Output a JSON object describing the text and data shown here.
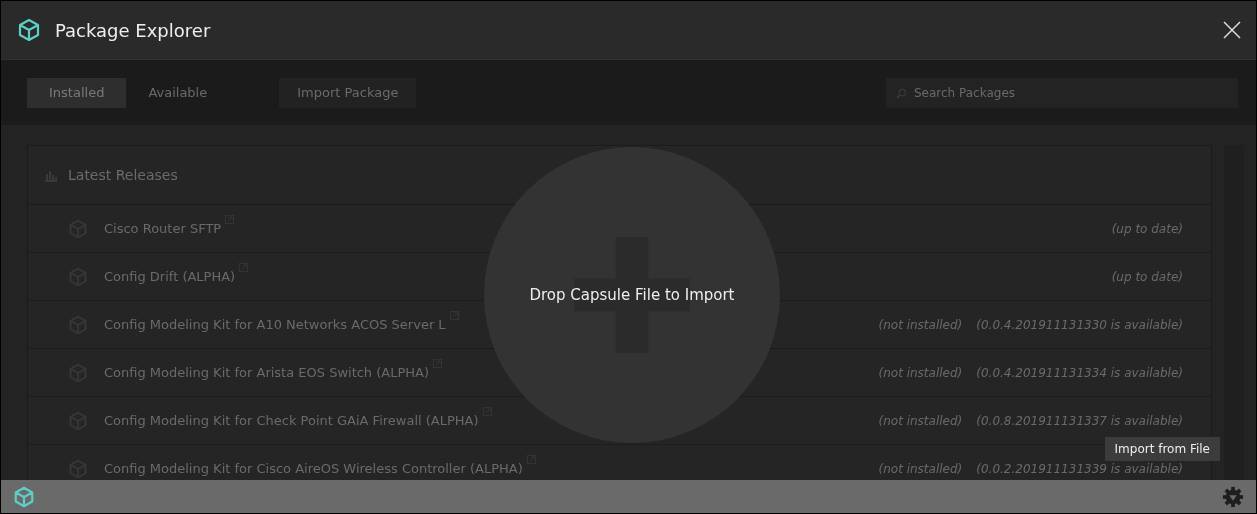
{
  "window": {
    "title": "Package Explorer"
  },
  "tabs": [
    {
      "label": "Installed",
      "selected": true
    },
    {
      "label": "Available",
      "selected": false
    }
  ],
  "import_button": "Import Package",
  "search": {
    "placeholder": "Search Packages"
  },
  "section": {
    "title": "Latest Releases"
  },
  "packages": [
    {
      "name": "Cisco Router SFTP",
      "status": "(up to date)"
    },
    {
      "name": "Config Drift (ALPHA)",
      "status": "(up to date)"
    },
    {
      "name": "Config Modeling Kit for A10 Networks ACOS Server L",
      "status": "(not installed)",
      "available": "(0.0.4.201911131330 is available)"
    },
    {
      "name": "Config Modeling Kit for Arista EOS Switch (ALPHA)",
      "status": "(not installed)",
      "available": "(0.0.4.201911131334 is available)"
    },
    {
      "name": "Config Modeling Kit for Check Point GAiA Firewall (ALPHA)",
      "status": "(not installed)",
      "available": "(0.0.8.201911131337 is available)"
    },
    {
      "name": "Config Modeling Kit for Cisco AireOS Wireless Controller (ALPHA)",
      "status": "(not installed)",
      "available": "(0.0.2.201911131339 is available)"
    }
  ],
  "drop_zone": {
    "label": "Drop Capsule File to Import"
  },
  "tooltip": "Import from File"
}
